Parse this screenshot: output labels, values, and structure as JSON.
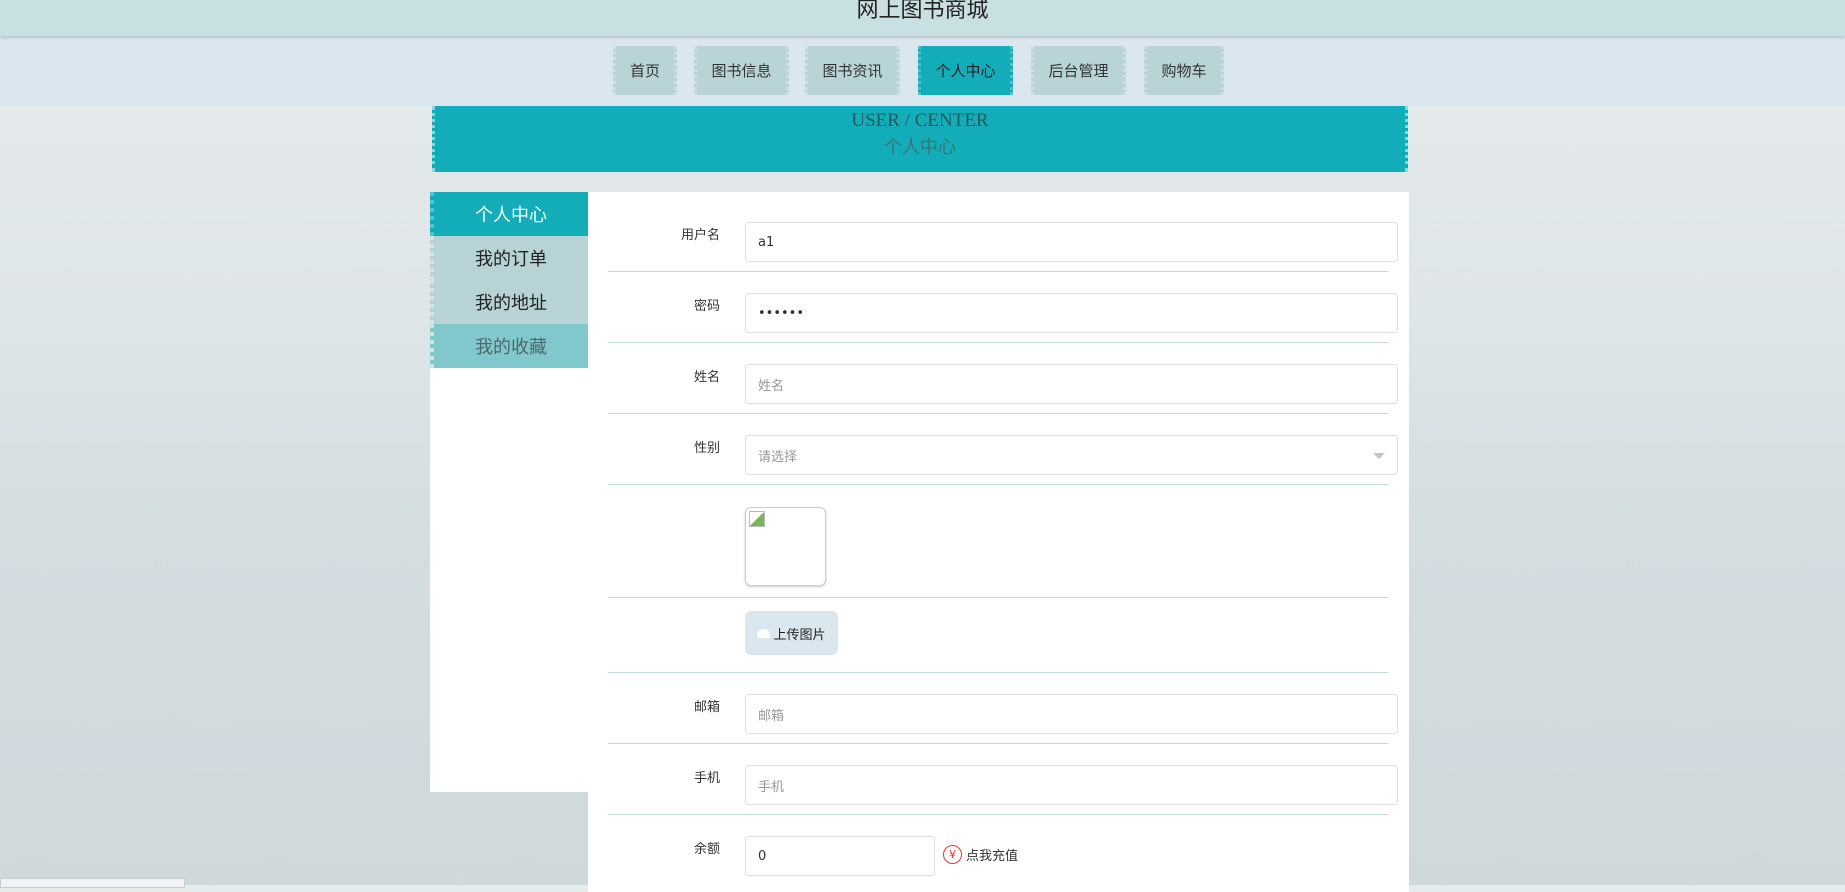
{
  "header": {
    "title": "网上图书商城"
  },
  "nav": {
    "items": [
      {
        "label": "首页"
      },
      {
        "label": "图书信息"
      },
      {
        "label": "图书资讯"
      },
      {
        "label": "个人中心"
      },
      {
        "label": "后台管理"
      },
      {
        "label": "购物车"
      }
    ],
    "active": "个人中心"
  },
  "banner": {
    "en": "USER / CENTER",
    "cn": "个人中心"
  },
  "sidebar": {
    "items": [
      {
        "label": "个人中心"
      },
      {
        "label": "我的订单"
      },
      {
        "label": "我的地址"
      },
      {
        "label": "我的收藏"
      }
    ]
  },
  "form": {
    "username": {
      "label": "用户名",
      "value": "a1"
    },
    "password": {
      "label": "密码",
      "value": "••••••"
    },
    "name": {
      "label": "姓名",
      "placeholder": "姓名"
    },
    "gender": {
      "label": "性别",
      "placeholder": "请选择"
    },
    "upload_label": "上传图片",
    "email": {
      "label": "邮箱",
      "placeholder": "邮箱"
    },
    "phone": {
      "label": "手机",
      "placeholder": "手机"
    },
    "balance": {
      "label": "余额",
      "value": "0"
    },
    "recharge_label": "点我充值",
    "yen_symbol": "¥"
  },
  "colors": {
    "accent": "#12adb8",
    "nav_bg": "#b8d4d6"
  }
}
